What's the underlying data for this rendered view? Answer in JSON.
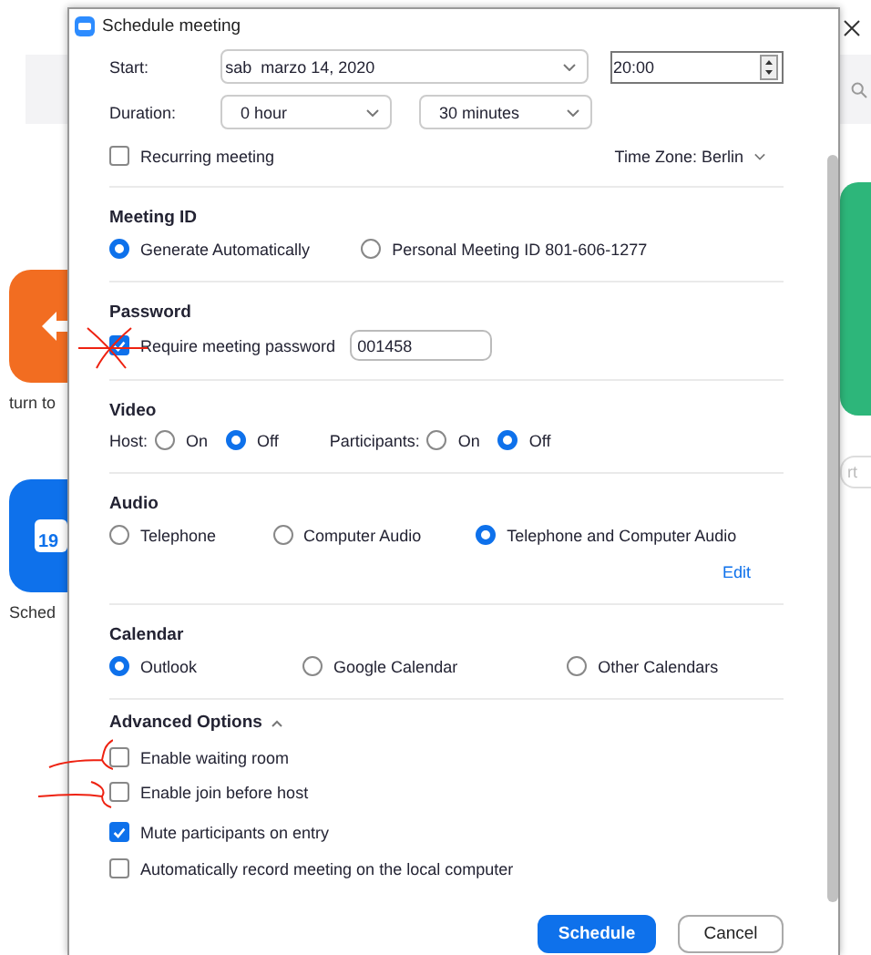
{
  "window": {
    "title": "Schedule meeting"
  },
  "start": {
    "label": "Start:",
    "date": "sab  marzo 14, 2020",
    "time": "20:00"
  },
  "duration": {
    "label": "Duration:",
    "hours": "0 hour",
    "minutes": "30 minutes"
  },
  "recurring": {
    "label": "Recurring meeting",
    "checked": false
  },
  "time_zone": "Time Zone: Berlin",
  "meeting_id": {
    "heading": "Meeting ID",
    "options": [
      {
        "label": "Generate Automatically",
        "selected": true
      },
      {
        "label": "Personal Meeting ID 801-606-1277",
        "selected": false
      }
    ]
  },
  "password": {
    "heading": "Password",
    "label": "Require meeting password",
    "checked": true,
    "value": "001458"
  },
  "video": {
    "heading": "Video",
    "groups": [
      {
        "label": "Host:",
        "options": [
          {
            "label": "On",
            "selected": false
          },
          {
            "label": "Off",
            "selected": true
          }
        ]
      },
      {
        "label": "Participants:",
        "options": [
          {
            "label": "On",
            "selected": false
          },
          {
            "label": "Off",
            "selected": true
          }
        ]
      }
    ]
  },
  "audio": {
    "heading": "Audio",
    "options": [
      {
        "label": "Telephone",
        "selected": false
      },
      {
        "label": "Computer Audio",
        "selected": false
      },
      {
        "label": "Telephone and Computer Audio",
        "selected": true
      }
    ],
    "link": "Edit"
  },
  "calendar": {
    "heading": "Calendar",
    "options": [
      {
        "label": "Outlook",
        "selected": true
      },
      {
        "label": "Google Calendar",
        "selected": false
      },
      {
        "label": "Other Calendars",
        "selected": false
      }
    ]
  },
  "advanced": {
    "heading": "Advanced Options",
    "expanded": true,
    "options": [
      {
        "label": "Enable waiting room",
        "checked": false
      },
      {
        "label": "Enable join before host",
        "checked": false
      },
      {
        "label": "Mute participants on entry",
        "checked": true
      },
      {
        "label": "Automatically record meeting on the local computer",
        "checked": false
      }
    ]
  },
  "buttons": [
    {
      "label": "Schedule",
      "kind": "primary"
    },
    {
      "label": "Cancel",
      "kind": "secondary"
    }
  ],
  "background": {
    "left_labels": [
      "turn to",
      "Sched"
    ],
    "calendar_day": "19",
    "right_button": "rt"
  }
}
